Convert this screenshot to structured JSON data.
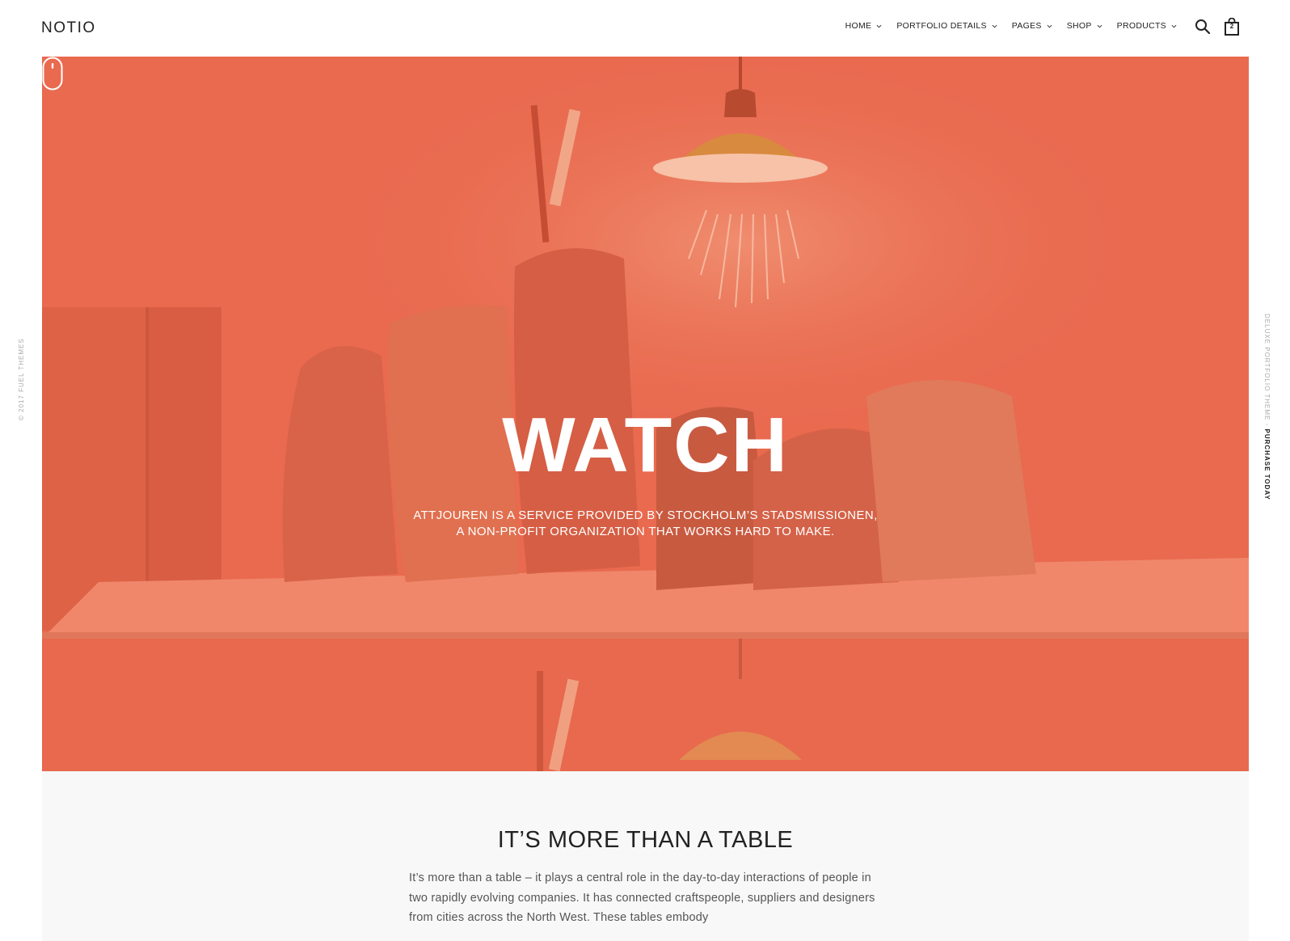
{
  "header": {
    "logo": "NOTIO",
    "nav": [
      {
        "label": "HOME"
      },
      {
        "label": "PORTFOLIO DETAILS"
      },
      {
        "label": "PAGES"
      },
      {
        "label": "SHOP"
      },
      {
        "label": "PRODUCTS"
      }
    ],
    "cart_count": "2"
  },
  "side": {
    "left_text": "© 2017 FUEL THEMES",
    "right_text": "DELUXE PORTFOLIO THEME - ",
    "right_cta": "PURCHASE TODAY"
  },
  "hero": {
    "title": "WATCH",
    "subtitle_line1": "ATTJOUREN IS A SERVICE PROVIDED BY STOCKHOLM’S STADSMISSIONEN,",
    "subtitle_line2": "A NON-PROFIT ORGANIZATION THAT WORKS HARD TO MAKE.",
    "overlay_color": "#e8694e"
  },
  "section": {
    "title": "IT’S MORE THAN A TABLE",
    "body": "It’s more than a table – it plays a central role in the day-to-day interactions of people in two rapidly evolving companies. It has connected craftspeople, suppliers and designers from cities across the North West. These tables embody"
  },
  "colors": {
    "accent": "#e8694e",
    "text": "#222222",
    "muted": "#555555",
    "section_bg": "#f8f8f8"
  }
}
